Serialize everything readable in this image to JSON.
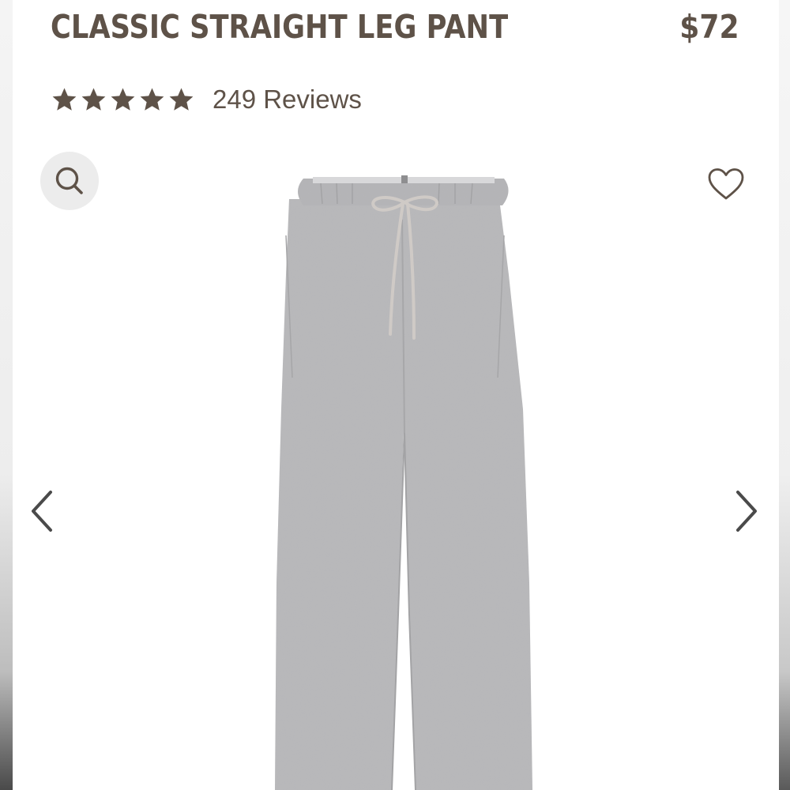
{
  "product": {
    "title": "CLASSIC STRAIGHT LEG PANT",
    "price": "$72"
  },
  "rating": {
    "stars": 5,
    "review_count_label": "249 Reviews"
  },
  "icons": {
    "zoom": "magnifier-icon",
    "wishlist": "heart-outline-icon",
    "prev": "chevron-left-icon",
    "next": "chevron-right-icon",
    "star": "star-filled-icon"
  },
  "colors": {
    "text_brand": "#5e5248",
    "zoom_button_bg": "#ececec",
    "pant_fabric": "#b7b7b9",
    "drawstring": "#cfcac6"
  }
}
